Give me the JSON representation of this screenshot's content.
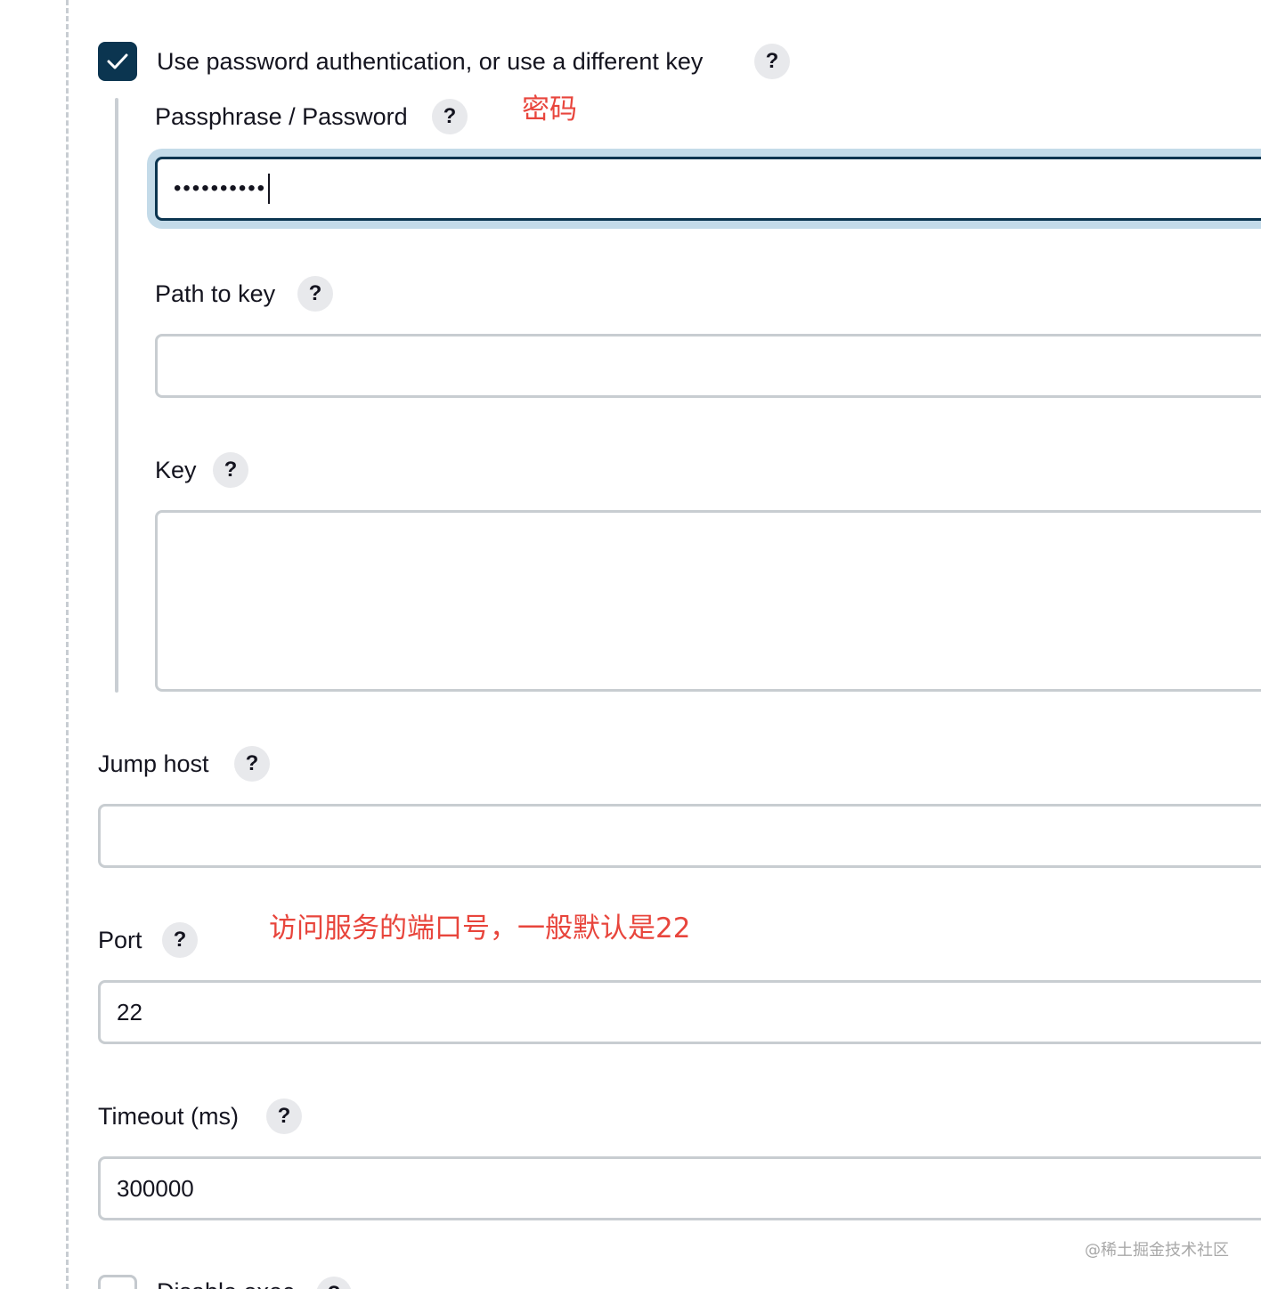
{
  "use_password": {
    "label": "Use password authentication, or use a different key",
    "checked": true
  },
  "passphrase": {
    "label": "Passphrase / Password",
    "masked_value": "••••••••••",
    "annotation": "密码"
  },
  "path_to_key": {
    "label": "Path to key",
    "value": ""
  },
  "key": {
    "label": "Key",
    "value": ""
  },
  "jump_host": {
    "label": "Jump host",
    "value": ""
  },
  "port": {
    "label": "Port",
    "value": "22",
    "annotation": "访问服务的端口号，一般默认是22"
  },
  "timeout": {
    "label": "Timeout (ms)",
    "value": "300000"
  },
  "disable_exec": {
    "label": "Disable exec",
    "checked": false
  },
  "help_glyph": "?",
  "watermark": "@稀土掘金技术社区",
  "colors": {
    "accent": "#0b3550",
    "focus_ring": "#c4dbe9",
    "annotation": "#e8453c",
    "border": "#c8cdd1"
  }
}
